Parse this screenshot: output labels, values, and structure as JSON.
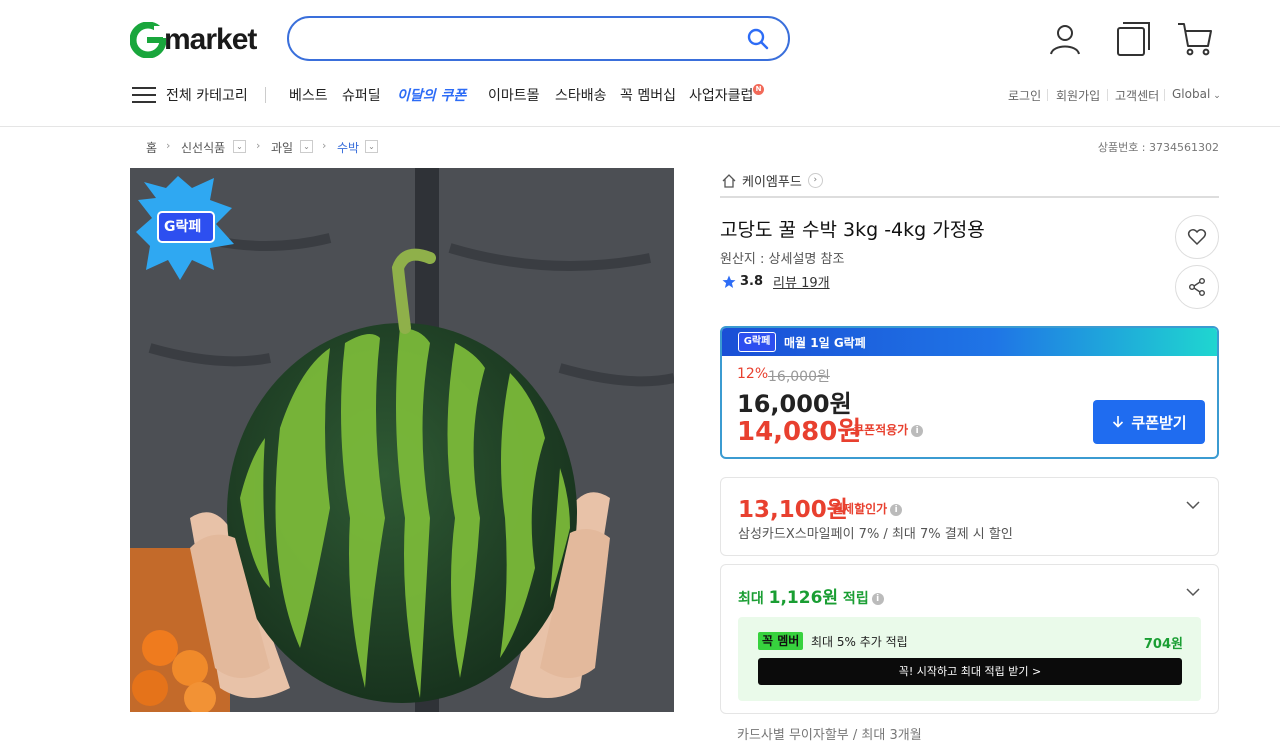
{
  "header": {
    "logo_text": "market",
    "search": {
      "placeholder": "",
      "value": ""
    },
    "icons": [
      "user-icon",
      "recent-view-icon",
      "cart-icon"
    ]
  },
  "nav": {
    "category_label": "전체 카테고리",
    "items": [
      "베스트",
      "슈퍼딜",
      "이달의 쿠폰",
      "이마트몰",
      "스타배송",
      "꼭 멤버십",
      "사업자클럽"
    ],
    "new_badge": "N",
    "utility": [
      "로그인",
      "회원가입",
      "고객센터",
      "Global"
    ]
  },
  "breadcrumb": {
    "items": [
      "홈",
      "신선식품",
      "과일",
      "수박"
    ],
    "goods_no": "상품번호 : 3734561302"
  },
  "product": {
    "seller": "케이엠푸드",
    "title": "고당도 꿀 수박 3kg -4kg 가정용",
    "origin": "원산지 : 상세설명 참조",
    "rating": "3.8",
    "review_label": "리뷰 19개",
    "image_badge": "G락페"
  },
  "price": {
    "banner_badge": "G락페",
    "banner_text": "매월 1일 G락페",
    "discount_rate": "12%",
    "original": "16,000원",
    "sale": "16,000원",
    "coupon_price": "14,080원",
    "coupon_label": "쿠폰적용가",
    "coupon_button": "쿠폰받기"
  },
  "card_discount": {
    "price": "13,100원",
    "label": "결제할인가",
    "desc": "삼성카드X스마일페이 7% / 최대 7% 결제 시 할인"
  },
  "points": {
    "prefix": "최대 ",
    "amount": "1,126원",
    "suffix": " 적립",
    "member_badge": "꼭 멤버",
    "member_text": "최대 5% 추가 적립",
    "member_points": "704원",
    "member_button": "꼭! 시작하고 최대 적립 받기 >"
  },
  "bottom_partial": "카드사별 무이자할부 / 최대 3개월",
  "colors": {
    "accent_blue": "#1f6cf0",
    "sale_red": "#e8402f",
    "point_green": "#1a9e33"
  }
}
